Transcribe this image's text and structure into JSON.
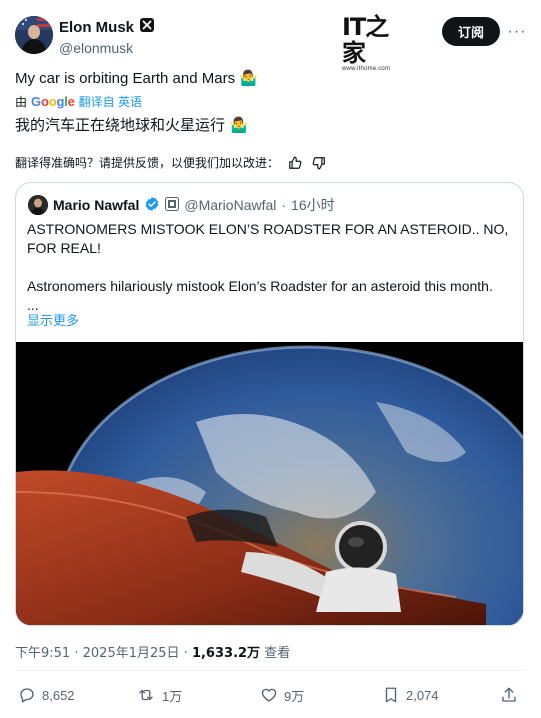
{
  "author": {
    "name": "Elon Musk",
    "handle": "@elonmusk",
    "verified_badge": "x-verified-badge"
  },
  "watermark": {
    "logo": "IT之家",
    "url": "www.ithome.com"
  },
  "subscribe_label": "订阅",
  "more_label": "···",
  "tweet": {
    "text": "My car is orbiting Earth and Mars 🤷‍♂️",
    "translate_prefix": "由",
    "translate_suffix": "翻译自 英语",
    "translated_text": "我的汽车正在绕地球和火星运行 🤷‍♂️",
    "feedback_prompt": "翻译得准确吗？请提供反馈，以便我们加以改进："
  },
  "quote": {
    "name": "Mario Nawfal",
    "handle": "@MarioNawfal",
    "separator": "·",
    "time": "16小时",
    "title": "ASTRONOMERS MISTOOK ELON’S ROADSTER FOR AN ASTEROID.. NO, FOR REAL!",
    "body": "Astronomers hilariously mistook Elon’s Roadster for an asteroid this month.",
    "ellipsis": "...",
    "show_more": "显示更多",
    "image_alt": "Tesla Roadster with Starman orbiting above Earth"
  },
  "meta": {
    "time": "下午9:51",
    "dot": "·",
    "date": "2025年1月25日",
    "views_count": "1,633.2万",
    "views_label": "查看"
  },
  "actions": {
    "replies": "8,652",
    "reposts": "1万",
    "likes": "9万",
    "bookmarks": "2,074"
  },
  "colors": {
    "accent": "#1d9bf0",
    "text": "#0f1419",
    "muted": "#536471",
    "border": "#cfd9de"
  }
}
